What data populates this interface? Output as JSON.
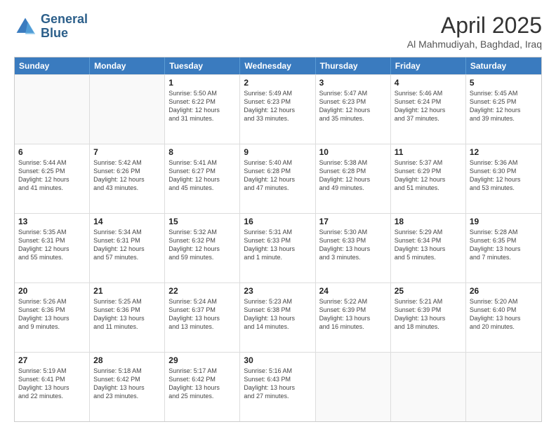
{
  "header": {
    "logo_line1": "General",
    "logo_line2": "Blue",
    "title": "April 2025",
    "subtitle": "Al Mahmudiyah, Baghdad, Iraq"
  },
  "weekdays": [
    "Sunday",
    "Monday",
    "Tuesday",
    "Wednesday",
    "Thursday",
    "Friday",
    "Saturday"
  ],
  "rows": [
    [
      {
        "day": "",
        "text": ""
      },
      {
        "day": "",
        "text": ""
      },
      {
        "day": "1",
        "text": "Sunrise: 5:50 AM\nSunset: 6:22 PM\nDaylight: 12 hours\nand 31 minutes."
      },
      {
        "day": "2",
        "text": "Sunrise: 5:49 AM\nSunset: 6:23 PM\nDaylight: 12 hours\nand 33 minutes."
      },
      {
        "day": "3",
        "text": "Sunrise: 5:47 AM\nSunset: 6:23 PM\nDaylight: 12 hours\nand 35 minutes."
      },
      {
        "day": "4",
        "text": "Sunrise: 5:46 AM\nSunset: 6:24 PM\nDaylight: 12 hours\nand 37 minutes."
      },
      {
        "day": "5",
        "text": "Sunrise: 5:45 AM\nSunset: 6:25 PM\nDaylight: 12 hours\nand 39 minutes."
      }
    ],
    [
      {
        "day": "6",
        "text": "Sunrise: 5:44 AM\nSunset: 6:25 PM\nDaylight: 12 hours\nand 41 minutes."
      },
      {
        "day": "7",
        "text": "Sunrise: 5:42 AM\nSunset: 6:26 PM\nDaylight: 12 hours\nand 43 minutes."
      },
      {
        "day": "8",
        "text": "Sunrise: 5:41 AM\nSunset: 6:27 PM\nDaylight: 12 hours\nand 45 minutes."
      },
      {
        "day": "9",
        "text": "Sunrise: 5:40 AM\nSunset: 6:28 PM\nDaylight: 12 hours\nand 47 minutes."
      },
      {
        "day": "10",
        "text": "Sunrise: 5:38 AM\nSunset: 6:28 PM\nDaylight: 12 hours\nand 49 minutes."
      },
      {
        "day": "11",
        "text": "Sunrise: 5:37 AM\nSunset: 6:29 PM\nDaylight: 12 hours\nand 51 minutes."
      },
      {
        "day": "12",
        "text": "Sunrise: 5:36 AM\nSunset: 6:30 PM\nDaylight: 12 hours\nand 53 minutes."
      }
    ],
    [
      {
        "day": "13",
        "text": "Sunrise: 5:35 AM\nSunset: 6:31 PM\nDaylight: 12 hours\nand 55 minutes."
      },
      {
        "day": "14",
        "text": "Sunrise: 5:34 AM\nSunset: 6:31 PM\nDaylight: 12 hours\nand 57 minutes."
      },
      {
        "day": "15",
        "text": "Sunrise: 5:32 AM\nSunset: 6:32 PM\nDaylight: 12 hours\nand 59 minutes."
      },
      {
        "day": "16",
        "text": "Sunrise: 5:31 AM\nSunset: 6:33 PM\nDaylight: 13 hours\nand 1 minute."
      },
      {
        "day": "17",
        "text": "Sunrise: 5:30 AM\nSunset: 6:33 PM\nDaylight: 13 hours\nand 3 minutes."
      },
      {
        "day": "18",
        "text": "Sunrise: 5:29 AM\nSunset: 6:34 PM\nDaylight: 13 hours\nand 5 minutes."
      },
      {
        "day": "19",
        "text": "Sunrise: 5:28 AM\nSunset: 6:35 PM\nDaylight: 13 hours\nand 7 minutes."
      }
    ],
    [
      {
        "day": "20",
        "text": "Sunrise: 5:26 AM\nSunset: 6:36 PM\nDaylight: 13 hours\nand 9 minutes."
      },
      {
        "day": "21",
        "text": "Sunrise: 5:25 AM\nSunset: 6:36 PM\nDaylight: 13 hours\nand 11 minutes."
      },
      {
        "day": "22",
        "text": "Sunrise: 5:24 AM\nSunset: 6:37 PM\nDaylight: 13 hours\nand 13 minutes."
      },
      {
        "day": "23",
        "text": "Sunrise: 5:23 AM\nSunset: 6:38 PM\nDaylight: 13 hours\nand 14 minutes."
      },
      {
        "day": "24",
        "text": "Sunrise: 5:22 AM\nSunset: 6:39 PM\nDaylight: 13 hours\nand 16 minutes."
      },
      {
        "day": "25",
        "text": "Sunrise: 5:21 AM\nSunset: 6:39 PM\nDaylight: 13 hours\nand 18 minutes."
      },
      {
        "day": "26",
        "text": "Sunrise: 5:20 AM\nSunset: 6:40 PM\nDaylight: 13 hours\nand 20 minutes."
      }
    ],
    [
      {
        "day": "27",
        "text": "Sunrise: 5:19 AM\nSunset: 6:41 PM\nDaylight: 13 hours\nand 22 minutes."
      },
      {
        "day": "28",
        "text": "Sunrise: 5:18 AM\nSunset: 6:42 PM\nDaylight: 13 hours\nand 23 minutes."
      },
      {
        "day": "29",
        "text": "Sunrise: 5:17 AM\nSunset: 6:42 PM\nDaylight: 13 hours\nand 25 minutes."
      },
      {
        "day": "30",
        "text": "Sunrise: 5:16 AM\nSunset: 6:43 PM\nDaylight: 13 hours\nand 27 minutes."
      },
      {
        "day": "",
        "text": ""
      },
      {
        "day": "",
        "text": ""
      },
      {
        "day": "",
        "text": ""
      }
    ]
  ]
}
